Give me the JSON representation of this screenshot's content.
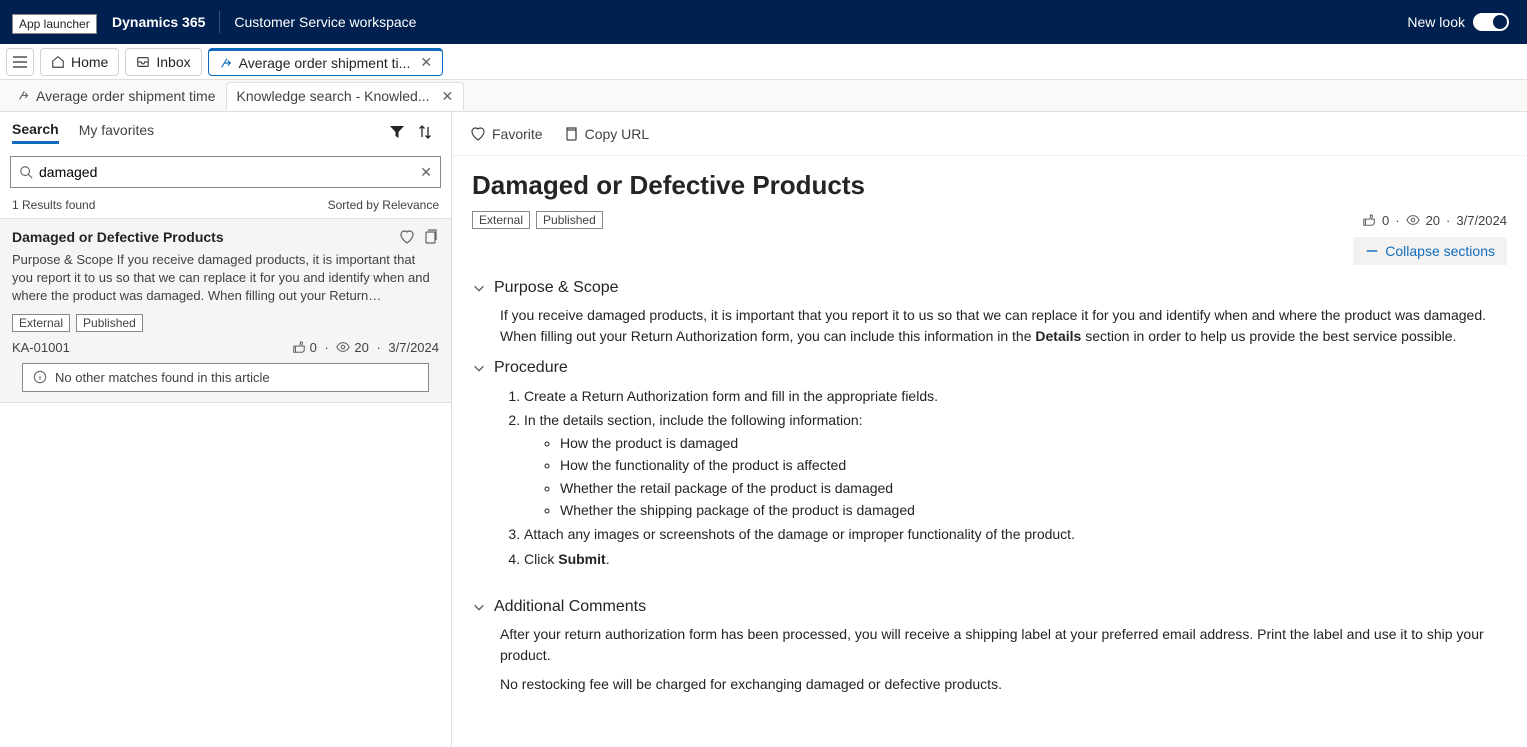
{
  "topbar": {
    "app_launcher_tooltip": "App launcher",
    "brand": "Dynamics 365",
    "workspace": "Customer Service workspace",
    "new_look_label": "New look"
  },
  "row1": {
    "home": "Home",
    "inbox": "Inbox",
    "tab_active": "Average order shipment ti..."
  },
  "row2": {
    "sub1": "Average order shipment time",
    "sub2": "Knowledge search - Knowled..."
  },
  "search_panel": {
    "tab_search": "Search",
    "tab_favorites": "My favorites",
    "search_value": "damaged",
    "results_found": "1 Results found",
    "sorted_by": "Sorted by Relevance",
    "result": {
      "title": "Damaged or Defective Products",
      "snippet": "Purpose & Scope If you receive damaged products, it is important that you report it to us so that we can replace it for you and identify when and where the product was damaged. When filling out your Return…",
      "badge_external": "External",
      "badge_published": "Published",
      "id": "KA-01001",
      "likes": "0",
      "views": "20",
      "date": "3/7/2024"
    },
    "no_matches": "No other matches found in this article"
  },
  "article": {
    "action_favorite": "Favorite",
    "action_copy": "Copy URL",
    "title": "Damaged or Defective Products",
    "badge_external": "External",
    "badge_published": "Published",
    "likes": "0",
    "views": "20",
    "date": "3/7/2024",
    "collapse_label": "Collapse sections",
    "section1": {
      "heading": "Purpose & Scope",
      "p1a": "If you receive damaged products, it is important that you report it to us so that we can replace it for you and identify when and where the product was damaged. When filling out your Return Authorization form, you can include this information in the ",
      "p1b": "Details",
      "p1c": " section in order to help us provide the best service possible."
    },
    "section2": {
      "heading": "Procedure",
      "step1": "Create a Return Authorization form and fill in the appropriate fields.",
      "step2": "In the details section, include the following information:",
      "bullet1": "How the product is damaged",
      "bullet2": "How the functionality of the product is affected",
      "bullet3": "Whether the retail package of the product is damaged",
      "bullet4": "Whether the shipping package of the product is damaged",
      "step3": "Attach any images or screenshots of the damage or improper functionality of the product.",
      "step4a": "Click ",
      "step4b": "Submit",
      "step4c": "."
    },
    "section3": {
      "heading": "Additional Comments",
      "p1": "After your return authorization form has been processed, you will receive a shipping label at your preferred email address. Print the label and use it to ship your product.",
      "p2": "No restocking fee will be charged for exchanging damaged or defective products."
    }
  }
}
